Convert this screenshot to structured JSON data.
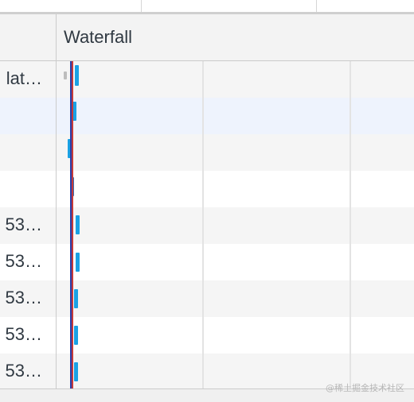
{
  "header": {
    "waterfall_title": "Waterfall"
  },
  "rows": [
    {
      "name": "lat…",
      "style": "alt"
    },
    {
      "name": "",
      "style": "selected"
    },
    {
      "name": "",
      "style": "alt"
    },
    {
      "name": "",
      "style": "white"
    },
    {
      "name": "53…",
      "style": "alt"
    },
    {
      "name": "53…",
      "style": "white"
    },
    {
      "name": "53…",
      "style": "alt"
    },
    {
      "name": "53…",
      "style": "white"
    },
    {
      "name": "53…",
      "style": "alt"
    }
  ],
  "watermark": "@稀土掘金技术社区",
  "colors": {
    "bar": "#1aa1e4",
    "dom_content_loaded_line": "#2a3da8",
    "load_line": "#c43a3a",
    "selected_row": "#eef3fd"
  }
}
